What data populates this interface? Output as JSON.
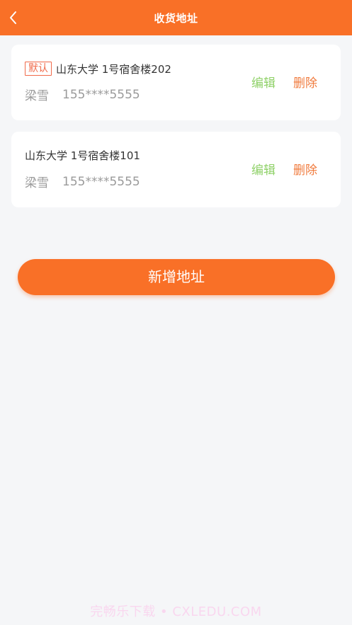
{
  "header": {
    "title": "收货地址",
    "back_icon": "chevron-left-icon"
  },
  "addresses": [
    {
      "default_tag": "默认",
      "address": "山东大学 1号宿舍楼202",
      "name": "梁雪",
      "phone": "155****5555",
      "edit_label": "编辑",
      "delete_label": "删除"
    },
    {
      "address": "山东大学 1号宿舍楼101",
      "name": "梁雪",
      "phone": "155****5555",
      "edit_label": "编辑",
      "delete_label": "删除"
    }
  ],
  "add_button": {
    "label": "新增地址"
  },
  "watermark": "完畅乐下载 • CXLEDU.COM",
  "colors": {
    "brand": "#f97027",
    "edit": "#8fd168",
    "delete": "#f07a3c",
    "default_tag": "#f06a4a",
    "background": "#f5f6f8"
  }
}
